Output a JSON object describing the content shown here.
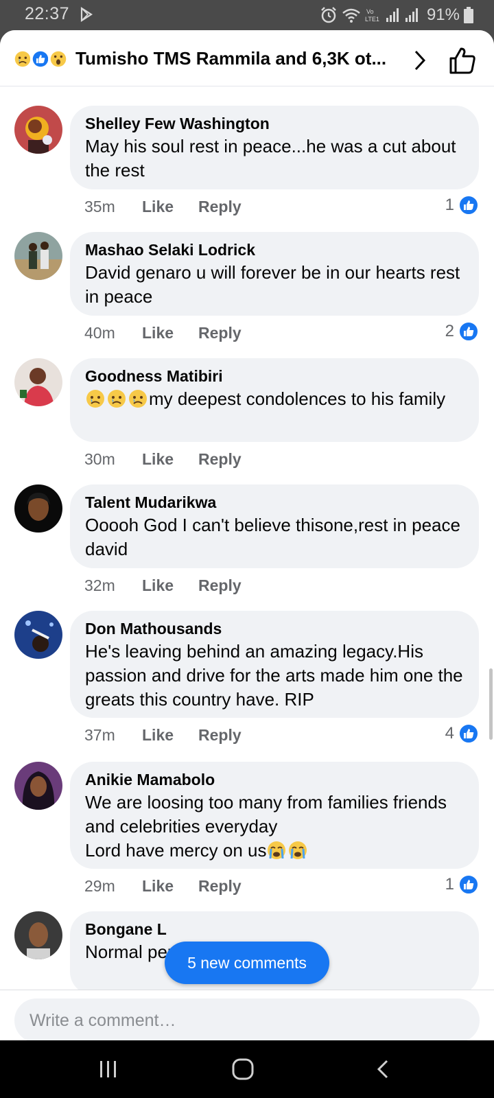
{
  "status_bar": {
    "time": "22:37",
    "battery_percent": "91%",
    "network_label": "Vo LTE1"
  },
  "header": {
    "title": "Tumisho TMS Rammila and 6,3K ot...",
    "reaction_icons": [
      "sad-emoji-icon",
      "like-reaction-icon",
      "wow-emoji-icon"
    ]
  },
  "comments": [
    {
      "author": "Shelley Few Washington",
      "text": "May his soul rest in peace...he was a cut about the rest",
      "time": "35m",
      "like_label": "Like",
      "reply_label": "Reply",
      "reactions": "1"
    },
    {
      "author": "Mashao Selaki Lodrick",
      "text": "David genaro  u will forever be in our hearts rest in peace",
      "time": "40m",
      "like_label": "Like",
      "reply_label": "Reply",
      "reactions": "2"
    },
    {
      "author": "Goodness Matibiri",
      "text": "my deepest condolences to his family",
      "emoji_prefix": [
        "sad-emoji-icon",
        "sad-emoji-icon",
        "sad-emoji-icon"
      ],
      "time": "30m",
      "like_label": "Like",
      "reply_label": "Reply",
      "reactions": ""
    },
    {
      "author": "Talent Mudarikwa",
      "text": "Ooooh God I can't believe thisone,rest in peace  david",
      "time": "32m",
      "like_label": "Like",
      "reply_label": "Reply",
      "reactions": ""
    },
    {
      "author": "Don Mathousands",
      "text": "He's leaving behind an amazing legacy.His passion and drive for the arts made him one the greats this country have. RIP",
      "time": "37m",
      "like_label": "Like",
      "reply_label": "Reply",
      "reactions": "4"
    },
    {
      "author": "Anikie Mamabolo",
      "text_line1": "We are loosing too many from families friends and celebrities everyday",
      "text_line2": "Lord have mercy on us",
      "emoji_suffix": [
        "crying-emoji-icon",
        "crying-emoji-icon"
      ],
      "time": "29m",
      "like_label": "Like",
      "reply_label": "Reply",
      "reactions": "1"
    },
    {
      "author": "Bongane L",
      "text": "Normal person .sit down"
    }
  ],
  "new_comments_label": "5 new comments",
  "composer": {
    "placeholder": "Write a comment…"
  },
  "navbar": {
    "icons": [
      "recent-apps-icon",
      "home-icon",
      "back-icon"
    ]
  },
  "colors": {
    "accent": "#1877f2",
    "bubble": "#f0f2f5",
    "secondary_text": "#65676b"
  }
}
